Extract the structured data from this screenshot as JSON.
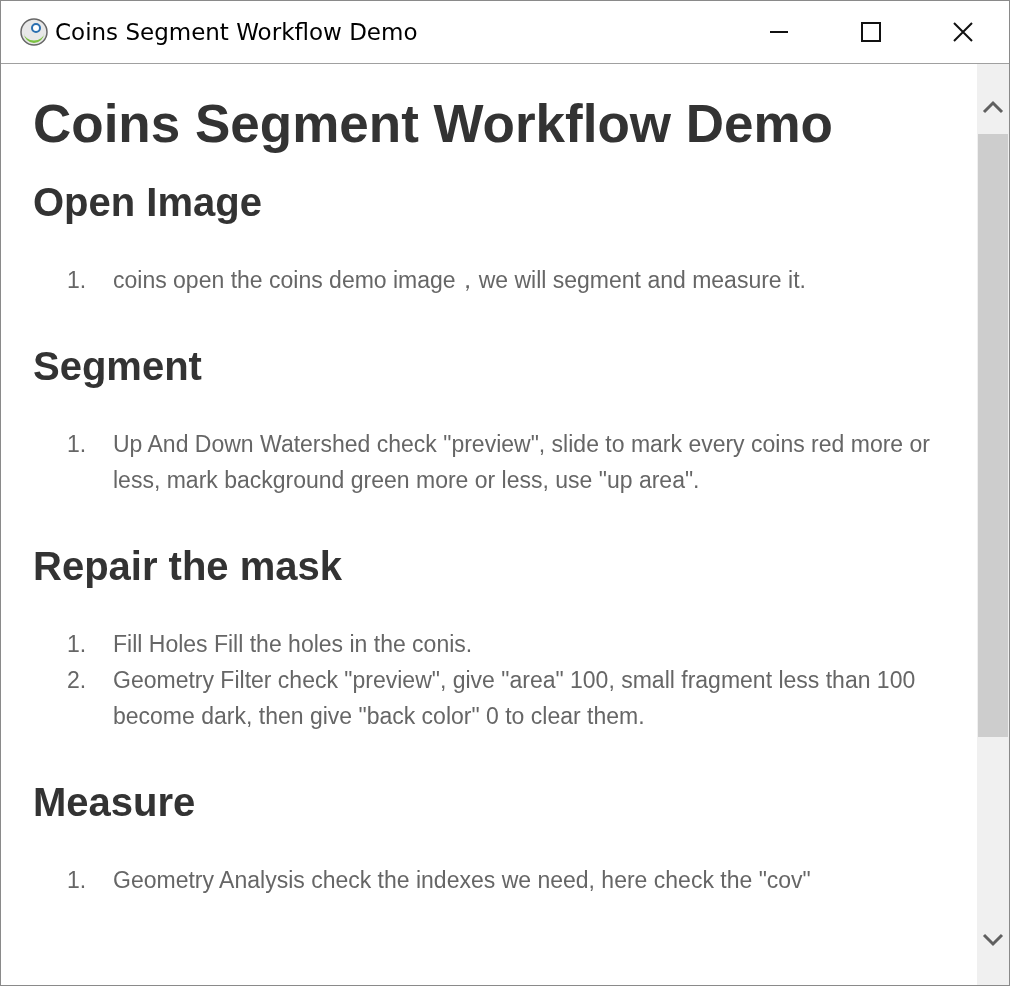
{
  "window": {
    "title": "Coins Segment Workflow Demo"
  },
  "page": {
    "title": "Coins Segment Workflow Demo",
    "sections": [
      {
        "heading": "Open Image",
        "items": [
          {
            "number": "1.",
            "text": "coins open the coins demo image，we will segment and measure it."
          }
        ]
      },
      {
        "heading": "Segment",
        "items": [
          {
            "number": "1.",
            "text": "Up And Down Watershed check \"preview\", slide to mark every coins red more or less, mark background green more or less, use \"up area\"."
          }
        ]
      },
      {
        "heading": "Repair the mask",
        "items": [
          {
            "number": "1.",
            "text": "Fill Holes Fill the holes in the conis."
          },
          {
            "number": "2.",
            "text": "Geometry Filter check \"preview\", give \"area\" 100, small fragment less than 100 become dark, then give \"back color\" 0 to clear them."
          }
        ]
      },
      {
        "heading": "Measure",
        "items": [
          {
            "number": "1.",
            "text": "Geometry Analysis check the indexes we need, here check the \"cov\""
          }
        ]
      }
    ]
  }
}
